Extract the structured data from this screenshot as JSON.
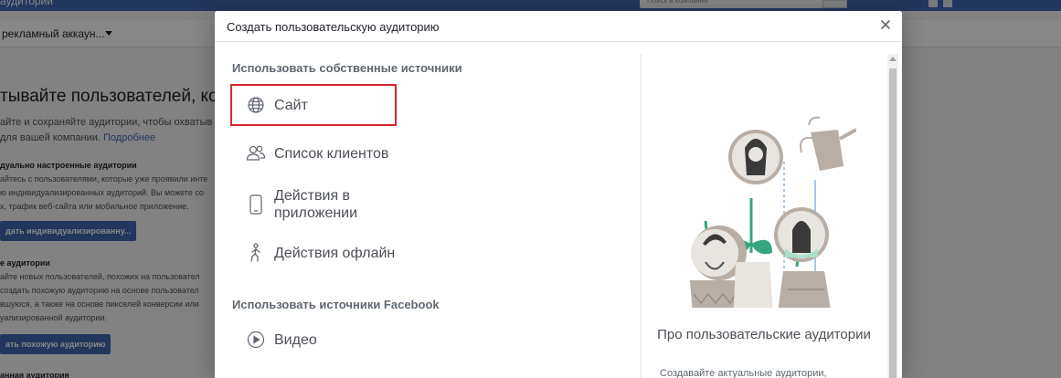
{
  "background": {
    "topbar_title": "аудитории",
    "search_placeholder": "Поиск в компании",
    "account_label": "рекламный аккаун...",
    "hero_title": "тывайте пользователей, которы",
    "hero_sub_line1": "айте и сохраняйте аудитории, чтобы охватыв",
    "hero_sub_line2": "для вашей компании.",
    "hero_link": "Подробнее",
    "section1_title": "дуально настроенные аудитории",
    "section1_line1": "айтесь с пользователями, которые уже проявили инте",
    "section1_line2": "ю индивидуализированных аудиторий. Вы можете со",
    "section1_line3": "х, трафик веб-сайта или мобильное приложение.",
    "section1_button": "дать индивидуализированну...",
    "section2_title": "е аудитории",
    "section2_line1": "айте новых пользователей, похожих на пользовател",
    "section2_line2": "создать похожую аудиторию на основе пользовател",
    "section2_line3": "вшуюся, а также на основе пикселей конверсии или",
    "section2_line4": "уализированной аудитории.",
    "section2_button": "ать похожую аудиторию",
    "section3_title": "анная аудитория"
  },
  "modal": {
    "title": "Создать пользовательскую аудиторию",
    "own_sources_title": "Использовать собственные источники",
    "own_sources": [
      {
        "label": "Сайт",
        "icon": "globe-icon"
      },
      {
        "label": "Список клиентов",
        "icon": "people-icon"
      },
      {
        "label": "Действия в приложении",
        "icon": "phone-icon"
      },
      {
        "label": "Действия офлайн",
        "icon": "person-walking-icon"
      }
    ],
    "fb_sources_title": "Использовать источники Facebook",
    "fb_sources": [
      {
        "label": "Видео",
        "icon": "play-icon"
      }
    ],
    "info_title": "Про пользовательские аудитории",
    "info_desc": "Создавайте актуальные аудитории, добавляя людей из самых подходящих"
  },
  "colors": {
    "facebook_blue": "#4267b2",
    "selection_red": "#d8262f",
    "muted_text": "#606770",
    "illustration_green": "#34a77f",
    "illustration_taupe": "#b8aea5"
  }
}
